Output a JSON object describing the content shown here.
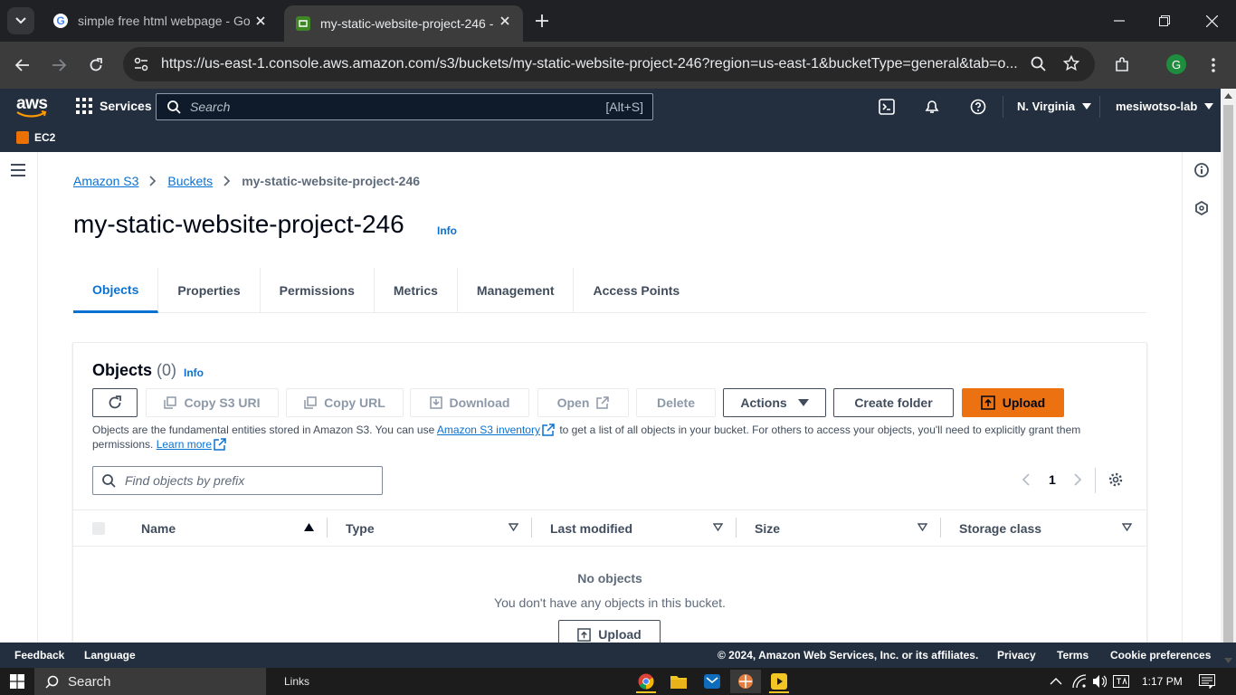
{
  "browser": {
    "tabs": [
      {
        "title": "simple free html webpage - Go",
        "active": false
      },
      {
        "title": "my-static-website-project-246 -",
        "active": true
      }
    ],
    "url": "https://us-east-1.console.aws.amazon.com/s3/buckets/my-static-website-project-246?region=us-east-1&bucketType=general&tab=o...",
    "profile_initial": "G"
  },
  "aws_header": {
    "logo": "aws",
    "services_label": "Services",
    "search_placeholder": "Search",
    "search_shortcut": "[Alt+S]",
    "region": "N. Virginia",
    "account": "mesiwotso-lab",
    "favorites": [
      {
        "label": "EC2"
      }
    ]
  },
  "breadcrumb": {
    "items": [
      "Amazon S3",
      "Buckets"
    ],
    "current": "my-static-website-project-246"
  },
  "page": {
    "title": "my-static-website-project-246",
    "info": "Info"
  },
  "tabs": [
    "Objects",
    "Properties",
    "Permissions",
    "Metrics",
    "Management",
    "Access Points"
  ],
  "objects_panel": {
    "title": "Objects",
    "count": "(0)",
    "info": "Info",
    "buttons": {
      "copy_s3_uri": "Copy S3 URI",
      "copy_url": "Copy URL",
      "download": "Download",
      "open": "Open",
      "delete": "Delete",
      "actions": "Actions",
      "create_folder": "Create folder",
      "upload": "Upload"
    },
    "description_part1": "Objects are the fundamental entities stored in Amazon S3. You can use",
    "description_link": "Amazon S3 inventory",
    "description_part2": "to get a list of all objects in your bucket. For others to access your objects, you'll need to explicitly grant them permissions.",
    "learn_more": "Learn more",
    "filter_placeholder": "Find objects by prefix",
    "page_number": "1",
    "columns": [
      "Name",
      "Type",
      "Last modified",
      "Size",
      "Storage class"
    ],
    "empty_title": "No objects",
    "empty_subtitle": "You don't have any objects in this bucket.",
    "empty_upload": "Upload"
  },
  "footer": {
    "feedback": "Feedback",
    "language": "Language",
    "copyright": "© 2024, Amazon Web Services, Inc. or its affiliates.",
    "privacy": "Privacy",
    "terms": "Terms",
    "cookies": "Cookie preferences"
  },
  "taskbar": {
    "search": "Search",
    "links": "Links",
    "time": "1:17 PM"
  },
  "colors": {
    "aws_nav": "#232f3e",
    "link_blue": "#0972d3",
    "upload_orange": "#ec7211"
  }
}
